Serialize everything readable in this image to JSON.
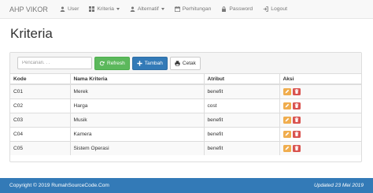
{
  "navbar": {
    "brand": "AHP VIKOR",
    "items": [
      {
        "label": "User",
        "icon": "user-icon"
      },
      {
        "label": "Kriteria",
        "icon": "th-large-icon",
        "dropdown": true
      },
      {
        "label": "Alternatif",
        "icon": "user-icon",
        "dropdown": true
      },
      {
        "label": "Perhitungan",
        "icon": "calendar-icon"
      },
      {
        "label": "Password",
        "icon": "lock-icon"
      },
      {
        "label": "Logout",
        "icon": "logout-icon"
      }
    ]
  },
  "page": {
    "title": "Kriteria"
  },
  "toolbar": {
    "search_placeholder": "Pencarian. . .",
    "refresh_label": "Refresh",
    "add_label": "Tambah",
    "print_label": "Cetak"
  },
  "table": {
    "headers": [
      "Kode",
      "Nama Kriteria",
      "Atribut",
      "Aksi"
    ],
    "rows": [
      {
        "kode": "C01",
        "nama": "Merek",
        "atribut": "benefit"
      },
      {
        "kode": "C02",
        "nama": "Harga",
        "atribut": "cost"
      },
      {
        "kode": "C03",
        "nama": "Musik",
        "atribut": "benefit"
      },
      {
        "kode": "C04",
        "nama": "Kamera",
        "atribut": "benefit"
      },
      {
        "kode": "C05",
        "nama": "Sistem Operasi",
        "atribut": "benefit"
      }
    ]
  },
  "footer": {
    "copyright": "Copyright © 2019 RumahSourceCode.Com",
    "updated": "Updated 23 Mei 2019"
  },
  "colors": {
    "navbar_bg": "#f8f8f8",
    "success": "#5cb85c",
    "primary": "#337ab7",
    "warning": "#f0ad4e",
    "danger": "#d9534f"
  }
}
